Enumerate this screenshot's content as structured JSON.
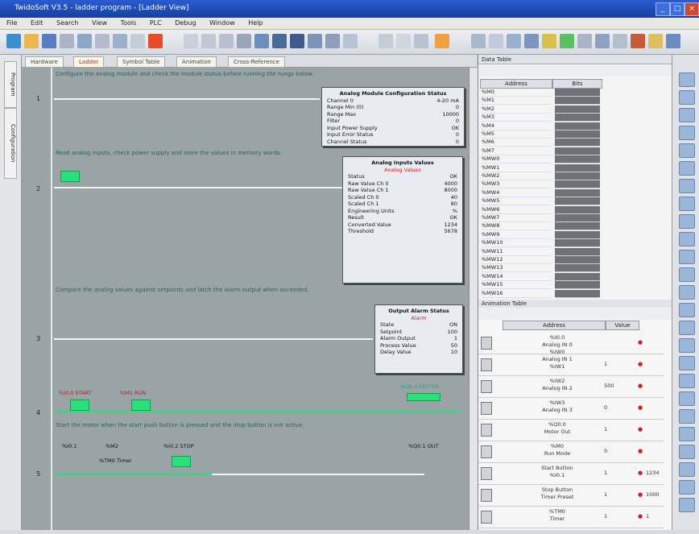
{
  "window": {
    "title": "TwidoSoft V3.5 - ladder program - [Ladder View]",
    "controls": [
      "_",
      "□",
      "×"
    ]
  },
  "menu": [
    "File",
    "Edit",
    "Search",
    "View",
    "Tools",
    "PLC",
    "Debug",
    "Window",
    "Help"
  ],
  "doc_tabs": [
    "Hardware",
    "Ladder",
    "Symbol Table",
    "Animation",
    "Cross-Reference"
  ],
  "left_tabs": [
    "Program",
    "Configuration"
  ],
  "ladder": {
    "rungs": [
      {
        "num": "1",
        "comment": "Configure the analog module and check the module status before running the rungs below."
      },
      {
        "num": "2",
        "comment": "Read analog inputs, check power supply and store the values in memory words."
      },
      {
        "num": "3",
        "comment": "Compare the analog values against setpoints and latch the alarm output when exceeded."
      },
      {
        "num": "4",
        "comment": ""
      },
      {
        "num": "5",
        "comment": "Start the motor when the start push button is pressed and the stop button is not active."
      }
    ],
    "contact_labels": [
      "%I0.0 START",
      "%M1 RUN",
      "%Q0.0 MOTOR"
    ],
    "rung5_labels": [
      "%I0.1",
      "%M2",
      "%I0.2 STOP",
      "%Q0.1 OUT",
      "%TM0 Timer"
    ],
    "panels": [
      {
        "title": "Analog Module Configuration Status",
        "rows": [
          [
            "Channel 0",
            "4-20 mA"
          ],
          [
            "Range Min (0)",
            "0"
          ],
          [
            "Range Max",
            "10000"
          ],
          [
            "Filter",
            "0"
          ],
          [
            "Input Power Supply",
            "OK"
          ],
          [
            "Input Error Status",
            "0"
          ],
          [
            "Channel Status",
            "0"
          ]
        ]
      },
      {
        "title": "Analog Inputs Values",
        "subtitle": "Analog Values",
        "rows": [
          [
            "Status",
            "OK"
          ],
          [
            "Raw Value Ch 0",
            "4000"
          ],
          [
            "Raw Value Ch 1",
            "8000"
          ],
          [
            "Scaled Ch 0",
            "40"
          ],
          [
            "Scaled Ch 1",
            "80"
          ],
          [
            "Engineering Units",
            "%"
          ],
          [
            "Result",
            "OK"
          ],
          [
            "Converted Value",
            "1234"
          ],
          [
            "Threshold",
            "5678"
          ]
        ]
      },
      {
        "title": "Output Alarm Status",
        "subtitle": "Alarm",
        "rows": [
          [
            "State",
            "ON"
          ],
          [
            "Setpoint",
            "100"
          ],
          [
            "Alarm Output",
            "1"
          ],
          [
            "Process Value",
            "50"
          ],
          [
            "Delay Value",
            "10"
          ]
        ]
      }
    ]
  },
  "data_table": {
    "header": "Data Table",
    "columns": [
      "Address",
      "Bits"
    ],
    "addresses": [
      "%M0",
      "%M1",
      "%M2",
      "%M3",
      "%M4",
      "%M5",
      "%M6",
      "%M7",
      "%MW0",
      "%MW1",
      "%MW2",
      "%MW3",
      "%MW4",
      "%MW5",
      "%MW6",
      "%MW7",
      "%MW8",
      "%MW9",
      "%MW10",
      "%MW11",
      "%MW12",
      "%MW13",
      "%MW14",
      "%MW15",
      "%MW16"
    ]
  },
  "animation_table": {
    "header": "Animation Table",
    "columns": [
      "Address",
      "Value"
    ],
    "rows": [
      {
        "name": [
          "%I0.0",
          "Analog IN 0",
          "%IW0"
        ],
        "value": ""
      },
      {
        "name": [
          "Analog IN 1",
          "%IW1"
        ],
        "value": "1"
      },
      {
        "name": [
          "%IW2",
          "Analog IN 2"
        ],
        "value": "500"
      },
      {
        "name": [
          "%IW3",
          "Analog IN 3"
        ],
        "value": "0"
      },
      {
        "name": [
          "%Q0.0",
          "Motor Out"
        ],
        "value": "1"
      },
      {
        "name": [
          "%M0",
          "Run Mode"
        ],
        "value": "0"
      },
      {
        "name": [
          "Start Button",
          "%I0.1"
        ],
        "value": "1"
      },
      {
        "name": [
          "Stop Button",
          "Timer Preset"
        ],
        "value": "1"
      },
      {
        "name": [
          "%TM0",
          "Timer"
        ],
        "value": "1"
      }
    ],
    "side_values": [
      "",
      "",
      "",
      "",
      "",
      "",
      "1234",
      "1000",
      "1"
    ]
  },
  "colors": {
    "titlebar": "#1c48b8",
    "ladder_bg": "#9aa4a6",
    "contact_on": "#29e07a",
    "comment": "#2e5f5f"
  }
}
